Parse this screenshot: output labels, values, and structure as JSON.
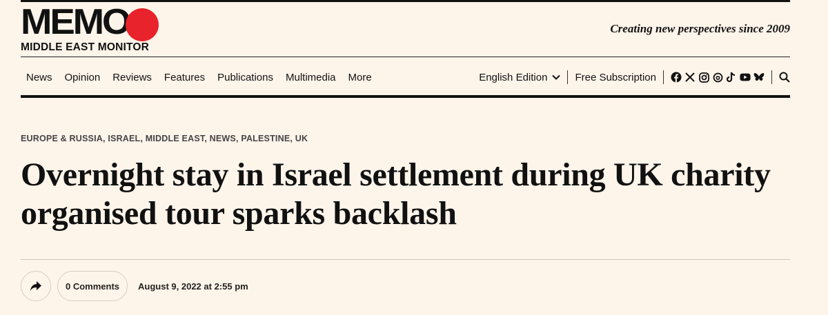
{
  "brand": {
    "logo_text": "MEMO",
    "logo_subtitle": "MIDDLE EAST MONITOR",
    "tagline": "Creating new perspectives since 2009",
    "accent_color": "#e8232b"
  },
  "nav": {
    "items": [
      "News",
      "Opinion",
      "Reviews",
      "Features",
      "Publications",
      "Multimedia",
      "More"
    ],
    "edition_label": "English Edition",
    "subscribe_label": "Free Subscription",
    "social_icons": [
      "facebook-icon",
      "x-icon",
      "instagram-icon",
      "threads-icon",
      "tiktok-icon",
      "youtube-icon",
      "bluesky-icon"
    ],
    "search_icon": "search-icon"
  },
  "article": {
    "categories": [
      "EUROPE & RUSSIA",
      "ISRAEL",
      "MIDDLE EAST",
      "NEWS",
      "PALESTINE",
      "UK"
    ],
    "title": "Overnight stay in Israel settlement during UK charity organised tour sparks backlash",
    "comments_label": "0 Comments",
    "date": "August 9, 2022 at 2:55 pm"
  }
}
